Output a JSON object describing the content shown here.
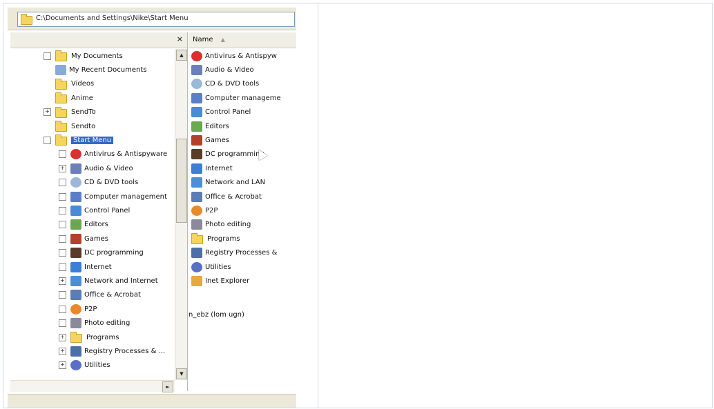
{
  "address_bar": {
    "path": "C:\\Documents and Settings\\Nike\\Start Menu"
  },
  "left_pane": {
    "close_label": "×",
    "tree": [
      {
        "label": "My Documents",
        "icon": "folder-icon",
        "toggle": "",
        "level": 1
      },
      {
        "label": "My Recent Documents",
        "icon": "recent-documents-icon",
        "toggle": "",
        "level": 1
      },
      {
        "label": "Videos",
        "icon": "folder-icon",
        "toggle": "",
        "level": 1
      },
      {
        "label": "Anime",
        "icon": "folder-icon",
        "toggle": "",
        "level": 1
      },
      {
        "label": "SendTo",
        "icon": "folder-icon",
        "toggle": "+",
        "level": 1
      },
      {
        "label": "Sendto",
        "icon": "folder-icon",
        "toggle": "",
        "level": 1
      },
      {
        "label": "Start Menu",
        "icon": "folder-icon",
        "toggle": "",
        "level": 1,
        "selected": true
      },
      {
        "label": "Antivirus & Antispyware",
        "icon": "antivirus-icon",
        "toggle": "",
        "level": 2
      },
      {
        "label": "Audio & Video",
        "icon": "audio-video-icon",
        "toggle": "+",
        "level": 2
      },
      {
        "label": "CD & DVD tools",
        "icon": "cd-dvd-icon",
        "toggle": "",
        "level": 2
      },
      {
        "label": "Computer management",
        "icon": "computer-management-icon",
        "toggle": "",
        "level": 2
      },
      {
        "label": "Control Panel",
        "icon": "control-panel-icon",
        "toggle": "",
        "level": 2
      },
      {
        "label": "Editors",
        "icon": "editors-icon",
        "toggle": "",
        "level": 2
      },
      {
        "label": "Games",
        "icon": "games-icon",
        "toggle": "",
        "level": 2
      },
      {
        "label": "DC programming",
        "icon": "programming-icon",
        "toggle": "",
        "level": 2
      },
      {
        "label": "Internet",
        "icon": "internet-icon",
        "toggle": "",
        "level": 2
      },
      {
        "label": "Network and Internet",
        "icon": "network-icon",
        "toggle": "+",
        "level": 2
      },
      {
        "label": "Office & Acrobat",
        "icon": "office-icon",
        "toggle": "",
        "level": 2
      },
      {
        "label": "P2P",
        "icon": "p2p-icon",
        "toggle": "",
        "level": 2
      },
      {
        "label": "Photo editing",
        "icon": "photo-editing-icon",
        "toggle": "",
        "level": 2
      },
      {
        "label": "Programs",
        "icon": "programs-icon",
        "toggle": "+",
        "level": 2
      },
      {
        "label": "Registry Processes & ...",
        "icon": "registry-icon",
        "toggle": "+",
        "level": 2
      },
      {
        "label": "Utilities",
        "icon": "utilities-icon",
        "toggle": "+",
        "level": 2
      }
    ]
  },
  "right_pane": {
    "column_header": "Name",
    "items": [
      {
        "label": "Antivirus & Antispyw",
        "icon": "antivirus-icon"
      },
      {
        "label": "Audio & Video",
        "icon": "audio-video-icon"
      },
      {
        "label": "CD & DVD tools",
        "icon": "cd-dvd-icon"
      },
      {
        "label": "Computer manageme",
        "icon": "computer-management-icon"
      },
      {
        "label": "Control Panel",
        "icon": "control-panel-icon"
      },
      {
        "label": "Editors",
        "icon": "editors-icon"
      },
      {
        "label": "Games",
        "icon": "games-icon"
      },
      {
        "label": "DC programming",
        "icon": "programming-icon"
      },
      {
        "label": "Internet",
        "icon": "internet-icon"
      },
      {
        "label": "Network and LAN",
        "icon": "network-icon"
      },
      {
        "label": "Office & Acrobat",
        "icon": "office-icon"
      },
      {
        "label": "P2P",
        "icon": "p2p-icon"
      },
      {
        "label": "Photo editing",
        "icon": "photo-editing-icon"
      },
      {
        "label": "Programs",
        "icon": "programs-icon"
      },
      {
        "label": "Registry Processes &",
        "icon": "registry-icon"
      },
      {
        "label": "Utilities",
        "icon": "utilities-icon"
      },
      {
        "label": "Inet Explorer",
        "icon": "explorer-icon"
      }
    ]
  },
  "stray_label": "n_ebz (lom ugn)",
  "icon_colors": {
    "folder-icon": "#f5d55f",
    "recent-documents-icon": "#8aa9d8",
    "antivirus-icon": "#d93030",
    "audio-video-icon": "#6c7fb8",
    "cd-dvd-icon": "#9bb8d8",
    "computer-management-icon": "#5b7fc7",
    "control-panel-icon": "#4b8ad6",
    "editors-icon": "#6aa84f",
    "games-icon": "#b5402a",
    "programming-icon": "#5a3b2a",
    "internet-icon": "#3b7fd6",
    "network-icon": "#4a90d9",
    "office-icon": "#5a7db5",
    "p2p-icon": "#e8892b",
    "photo-editing-icon": "#8a8a9a",
    "programs-icon": "#f5d55f",
    "registry-icon": "#4b6fa8",
    "utilities-icon": "#5b6fc7",
    "explorer-icon": "#e8a83b"
  }
}
